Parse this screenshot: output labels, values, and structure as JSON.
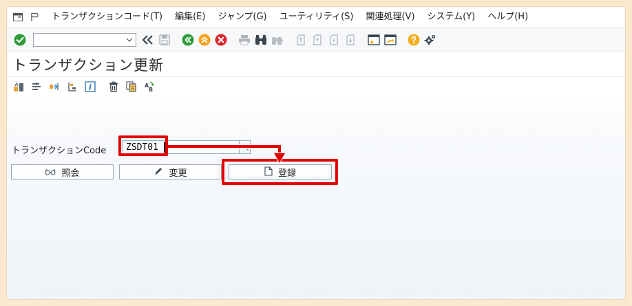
{
  "menu": {
    "items": [
      "トランザクションコード(T)",
      "編集(E)",
      "ジャンプ(G)",
      "ユーティリティ(S)",
      "関連処理(V)",
      "システム(Y)",
      "ヘルプ(H)"
    ]
  },
  "toolbar": {
    "command_value": ""
  },
  "title": {
    "text": "トランザクション更新"
  },
  "form": {
    "tcode_label": "トランザクションCode",
    "tcode_value": "ZSDT01"
  },
  "buttons": {
    "display_label": "照会",
    "change_label": "変更",
    "create_label": "登録"
  },
  "colors": {
    "highlight": "#e20000",
    "ok_green": "#2e9b3b",
    "nav_green": "#2e9b3b",
    "nav_orange": "#f4a21a",
    "cancel_red": "#d9262d",
    "help_yellow": "#f2b01e"
  },
  "icons": {
    "enter": "checkmark-circle-icon",
    "back_history": "double-chevron-left-icon",
    "save": "save-icon",
    "back": "back-icon",
    "exit": "exit-icon",
    "cancel": "cancel-icon",
    "print": "print-icon",
    "find": "binoculars-icon",
    "find_next": "binoculars-next-icon",
    "first_page": "first-page-icon",
    "prev_page": "previous-page-icon",
    "next_page": "next-page-icon",
    "last_page": "last-page-icon",
    "new_session": "new-session-icon",
    "shortcut": "shortcut-icon",
    "help": "help-icon",
    "settings": "settings-icon"
  }
}
